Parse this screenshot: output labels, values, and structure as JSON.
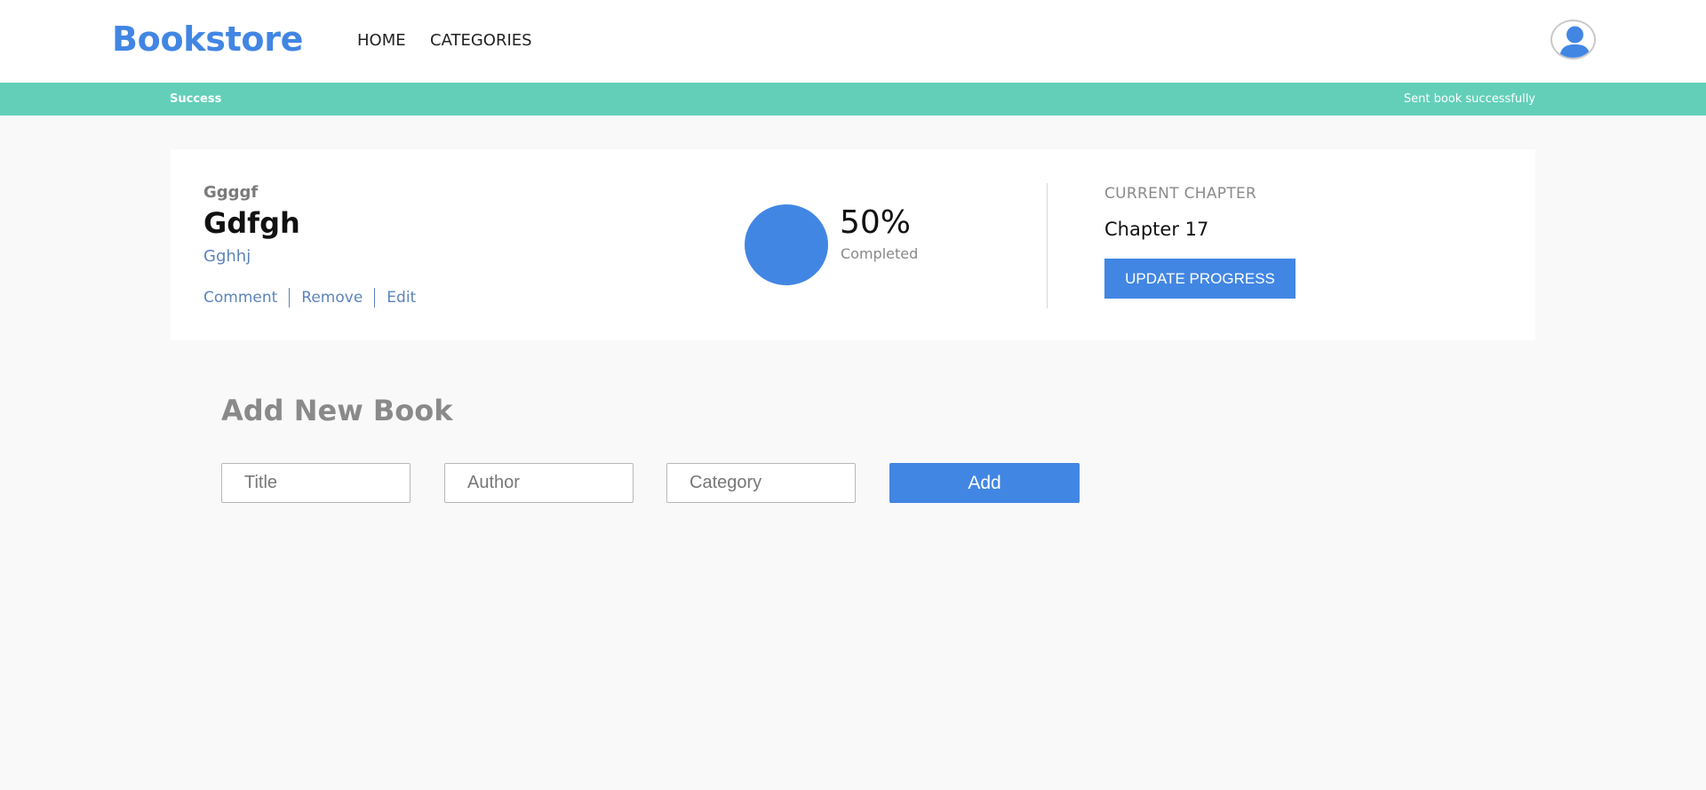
{
  "header": {
    "logo": "Bookstore",
    "nav": {
      "home": "HOME",
      "categories": "CATEGORIES"
    },
    "avatar_icon": "user-icon"
  },
  "alert": {
    "title": "Success",
    "message": "Sent book successfully",
    "color": "#63cfb9"
  },
  "book": {
    "author": "Ggggf",
    "title": "Gdfgh",
    "category": "Gghhj",
    "actions": {
      "comment": "Comment",
      "remove": "Remove",
      "edit": "Edit"
    },
    "progress": {
      "percent_text": "50%",
      "label": "Completed",
      "value": 0.5
    },
    "current_chapter": {
      "heading": "CURRENT CHAPTER",
      "value": "Chapter 17"
    },
    "update_button": "UPDATE PROGRESS"
  },
  "add_book": {
    "heading": "Add New Book",
    "title_placeholder": "Title",
    "author_placeholder": "Author",
    "category_placeholder": "Category",
    "add_button": "Add"
  },
  "colors": {
    "accent": "#4286e3",
    "link": "#5d83bb",
    "background": "#f9f9f9"
  }
}
